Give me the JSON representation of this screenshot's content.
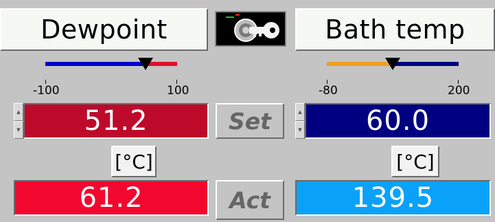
{
  "left": {
    "title": "Dewpoint",
    "scale_min": "-100",
    "scale_max": "100",
    "slider_fraction": 0.76,
    "set_value": "51.2",
    "unit": "[°C]",
    "act_value": "61.2",
    "colors": {
      "set_bg": "#bd0a2a",
      "act_bg": "#f2082f",
      "track_main": "#0000cc",
      "track_rest": "#e0102a"
    }
  },
  "center": {
    "set_label": "Set",
    "act_label": "Act",
    "icon": "key-lock-icon"
  },
  "right": {
    "title": "Bath temp",
    "scale_min": "-80",
    "scale_max": "200",
    "slider_fraction": 0.5,
    "set_value": "60.0",
    "unit": "[°C]",
    "act_value": "139.5",
    "colors": {
      "set_bg": "#000080",
      "act_bg": "#0aa2f8",
      "track_main": "#f0a020",
      "track_rest": "#000080"
    }
  }
}
